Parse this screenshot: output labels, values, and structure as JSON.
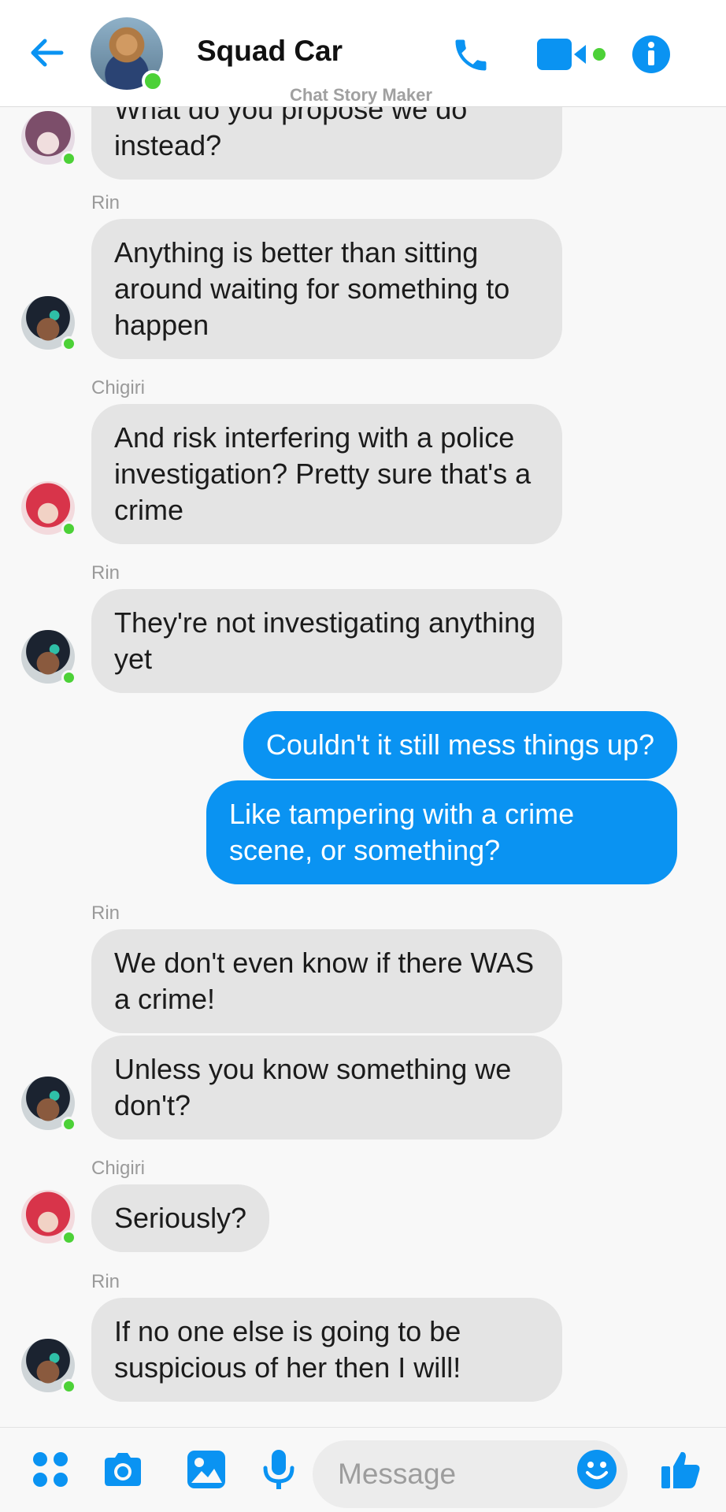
{
  "header": {
    "title": "Squad Car",
    "watermark": "Chat Story Maker"
  },
  "accent_color": "#0a93f2",
  "online_color": "#4cd137",
  "messages": [
    {
      "sender": "",
      "direction": "in",
      "text": "What do you propose we do instead?"
    },
    {
      "sender": "Rin",
      "direction": "in",
      "text": "Anything is better than sitting around waiting for something to happen"
    },
    {
      "sender": "Chigiri",
      "direction": "in",
      "text": "And risk interfering with a police investigation? Pretty sure that's a crime"
    },
    {
      "sender": "Rin",
      "direction": "in",
      "text": "They're not investigating anything yet"
    },
    {
      "sender": "",
      "direction": "out",
      "text": "Couldn't it still mess things up?"
    },
    {
      "sender": "",
      "direction": "out",
      "text": "Like tampering with a crime scene, or something?"
    },
    {
      "sender": "Rin",
      "direction": "in",
      "text": "We don't even know if there WAS a crime!"
    },
    {
      "sender": "",
      "direction": "in",
      "text": "Unless you know something we don't?"
    },
    {
      "sender": "Chigiri",
      "direction": "in",
      "text": "Seriously?"
    },
    {
      "sender": "Rin",
      "direction": "in",
      "text": "If no one else is going to be suspicious of her then I will!"
    }
  ],
  "composer": {
    "placeholder": "Message"
  },
  "icons": {
    "back": "arrow-left-icon",
    "call": "phone-icon",
    "video": "video-camera-icon",
    "info": "info-icon",
    "apps": "grid-dots-icon",
    "camera": "camera-icon",
    "gallery": "image-icon",
    "mic": "microphone-icon",
    "emoji": "smiley-icon",
    "like": "thumbs-up-icon"
  }
}
